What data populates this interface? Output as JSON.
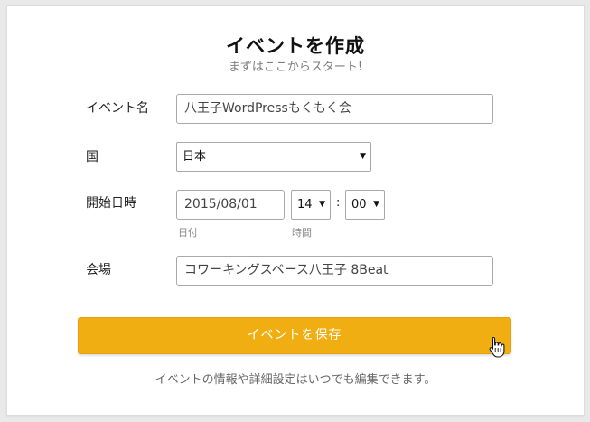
{
  "header": {
    "title": "イベントを作成",
    "subtitle": "まずはここからスタート!"
  },
  "form": {
    "event_name": {
      "label": "イベント名",
      "value": "八王子WordPressもくもく会"
    },
    "country": {
      "label": "国",
      "selected": "日本"
    },
    "datetime": {
      "label": "開始日時",
      "date_value": "2015/08/01",
      "date_hint": "日付",
      "hour_value": "14",
      "minute_value": "00",
      "time_hint": "時間",
      "separator": ":"
    },
    "venue": {
      "label": "会場",
      "value": "コワーキングスペース八王子 8Beat"
    }
  },
  "actions": {
    "save_label": "イベントを保存"
  },
  "footer": {
    "note": "イベントの情報や詳細設定はいつでも編集できます。"
  },
  "icons": {
    "dropdown": "triangle-down-icon",
    "cursor": "hand-pointer-icon"
  },
  "colors": {
    "accent": "#f0ae13",
    "background": "#e9e9e9",
    "card": "#ffffff"
  }
}
